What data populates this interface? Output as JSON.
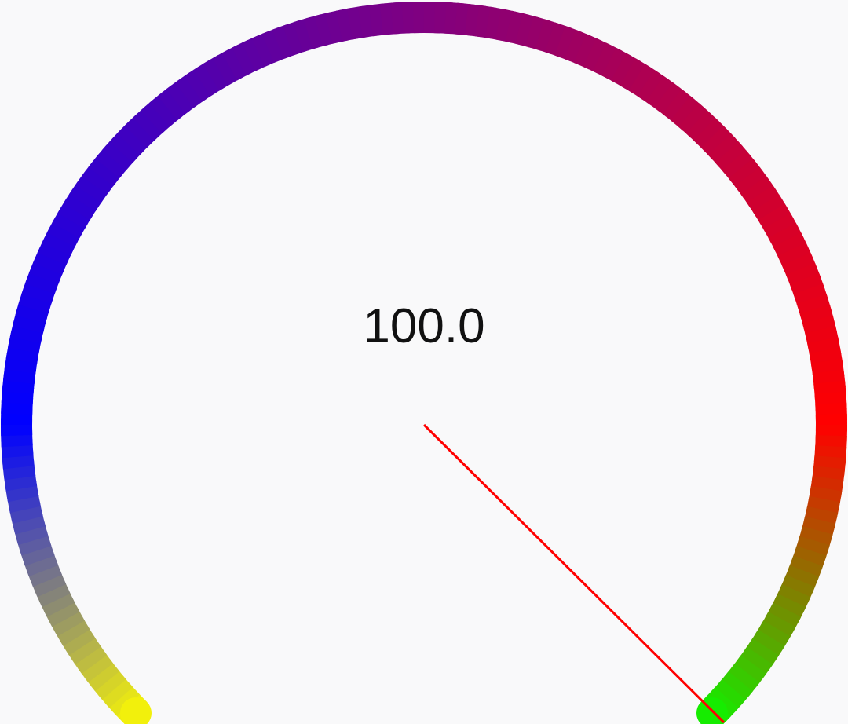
{
  "gauge": {
    "value_label": "100.0",
    "colors": {
      "background": "#f9f9fa",
      "text": "#111111",
      "needle": "#ff0000",
      "gradient_stops": [
        {
          "name": "start",
          "color": "#f2f00c"
        },
        {
          "name": "lower-left",
          "color": "#0000ff"
        },
        {
          "name": "top",
          "color": "#800080"
        },
        {
          "name": "right",
          "color": "#ff0000"
        },
        {
          "name": "end",
          "color": "#16ec00"
        }
      ]
    }
  }
}
